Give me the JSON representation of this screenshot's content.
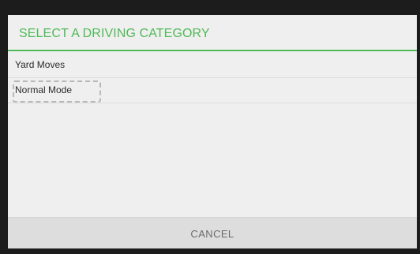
{
  "dialog": {
    "title": "SELECT A DRIVING CATEGORY",
    "items": [
      {
        "label": "Yard Moves"
      },
      {
        "label": "Normal Mode"
      }
    ],
    "cancel_label": "CANCEL"
  },
  "colors": {
    "accent": "#4fba57",
    "dialog_background": "#efefef",
    "footer_background": "#dddddd",
    "backdrop": "#1c1c1c"
  }
}
